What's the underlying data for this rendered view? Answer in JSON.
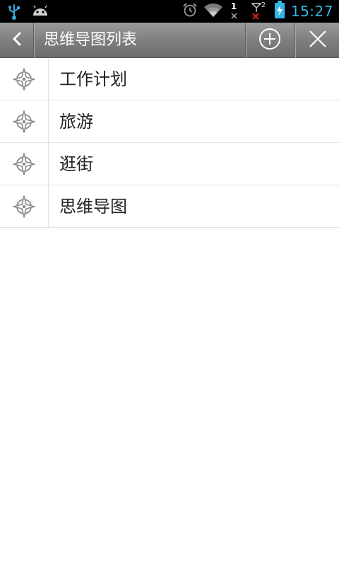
{
  "statusbar": {
    "time": "15:27",
    "signal_sim": "2",
    "notif_count": "1",
    "icons": [
      "usb-icon",
      "android-icon",
      "alarm-icon",
      "wifi-icon",
      "signal-icon",
      "battery-charging-icon"
    ]
  },
  "actionbar": {
    "title": "思维导图列表",
    "icons": [
      "back-chevron-icon",
      "add-circle-icon",
      "close-icon"
    ]
  },
  "list": {
    "items": [
      {
        "label": "工作计划",
        "icon": "mindmap-compass-icon"
      },
      {
        "label": "旅游",
        "icon": "mindmap-compass-icon"
      },
      {
        "label": "逛街",
        "icon": "mindmap-compass-icon"
      },
      {
        "label": "思维导图",
        "icon": "mindmap-compass-icon"
      }
    ]
  },
  "colors": {
    "statusbar_bg": "#000000",
    "time": "#33b5e5",
    "actionbar": "#7d7d7d",
    "divider": "#e2e2e2"
  }
}
